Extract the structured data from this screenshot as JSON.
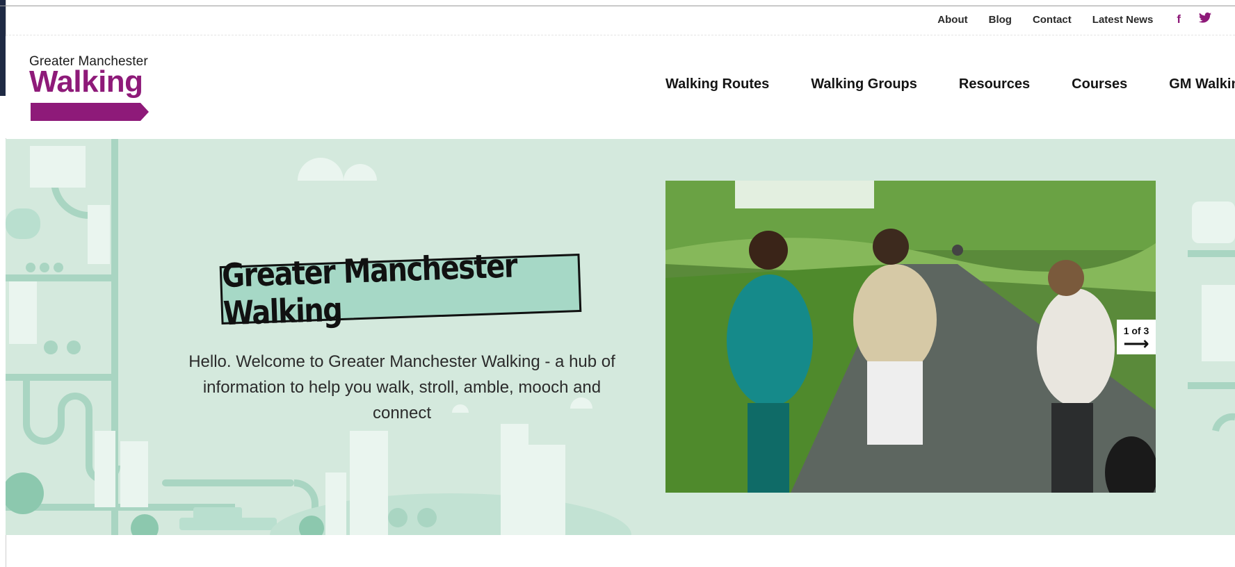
{
  "utility_nav": {
    "items": [
      "About",
      "Blog",
      "Contact",
      "Latest News"
    ],
    "social": [
      {
        "icon": "facebook-icon",
        "glyph": "f"
      },
      {
        "icon": "twitter-icon",
        "glyph": "t"
      }
    ]
  },
  "logo": {
    "line1": "Greater Manchester",
    "line2": "Walking"
  },
  "main_nav": {
    "items": [
      "Walking Routes",
      "Walking Groups",
      "Resources",
      "Courses",
      "GM Walking"
    ]
  },
  "hero": {
    "title": "Greater Manchester Walking",
    "intro": "Hello. Welcome to Greater Manchester Walking - a hub of information to help you walk, stroll, amble, mooch and connect",
    "slider": {
      "counter": "1 of 3",
      "next_glyph": "⟶"
    }
  },
  "colors": {
    "brand": "#8e1a79",
    "hero_bg": "#d4e9dd",
    "title_box": "#a6d8c6"
  }
}
